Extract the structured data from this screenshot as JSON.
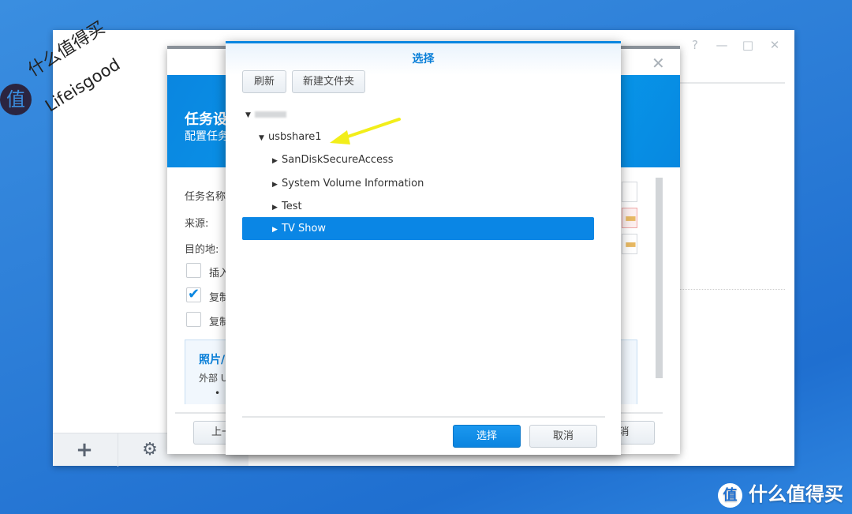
{
  "main_window": {
    "controls": {
      "help": "?",
      "minimize": "—",
      "maximize": "□",
      "close": "✕"
    },
    "toolbar": {
      "add": "+",
      "settings": "⚙"
    }
  },
  "wizard": {
    "close": "✕",
    "title": "任务设",
    "subtitle": "配置任务",
    "fields": [
      {
        "label": "任务名称"
      },
      {
        "label": "来源:"
      },
      {
        "label": "目的地:"
      }
    ],
    "options": [
      {
        "label": "插入",
        "checked": false
      },
      {
        "label": "复制",
        "checked": true
      },
      {
        "label": "复制",
        "checked": false
      }
    ],
    "info": {
      "title": "照片/",
      "text": "外部 U",
      "bullet": "•"
    },
    "back_label": "上一",
    "cancel_label": "消"
  },
  "picker": {
    "title": "选择",
    "refresh_label": "刷新",
    "new_folder_label": "新建文件夹",
    "tree": {
      "share": "usbshare1",
      "children": [
        {
          "label": "SanDiskSecureAccess",
          "selected": false
        },
        {
          "label": "System Volume Information",
          "selected": false
        },
        {
          "label": "Test",
          "selected": false
        },
        {
          "label": "TV Show",
          "selected": true
        }
      ]
    },
    "ok_label": "选择",
    "cancel_label": "取消"
  },
  "watermark": {
    "brand": "什么值得买",
    "tag": "Lifeisgood",
    "glyph": "值"
  },
  "logo": {
    "glyph": "值",
    "text": "什么值得买"
  },
  "colors": {
    "accent": "#0a86e5",
    "desktop": "#2a7bd6",
    "arrow": "#f2ee1a"
  }
}
